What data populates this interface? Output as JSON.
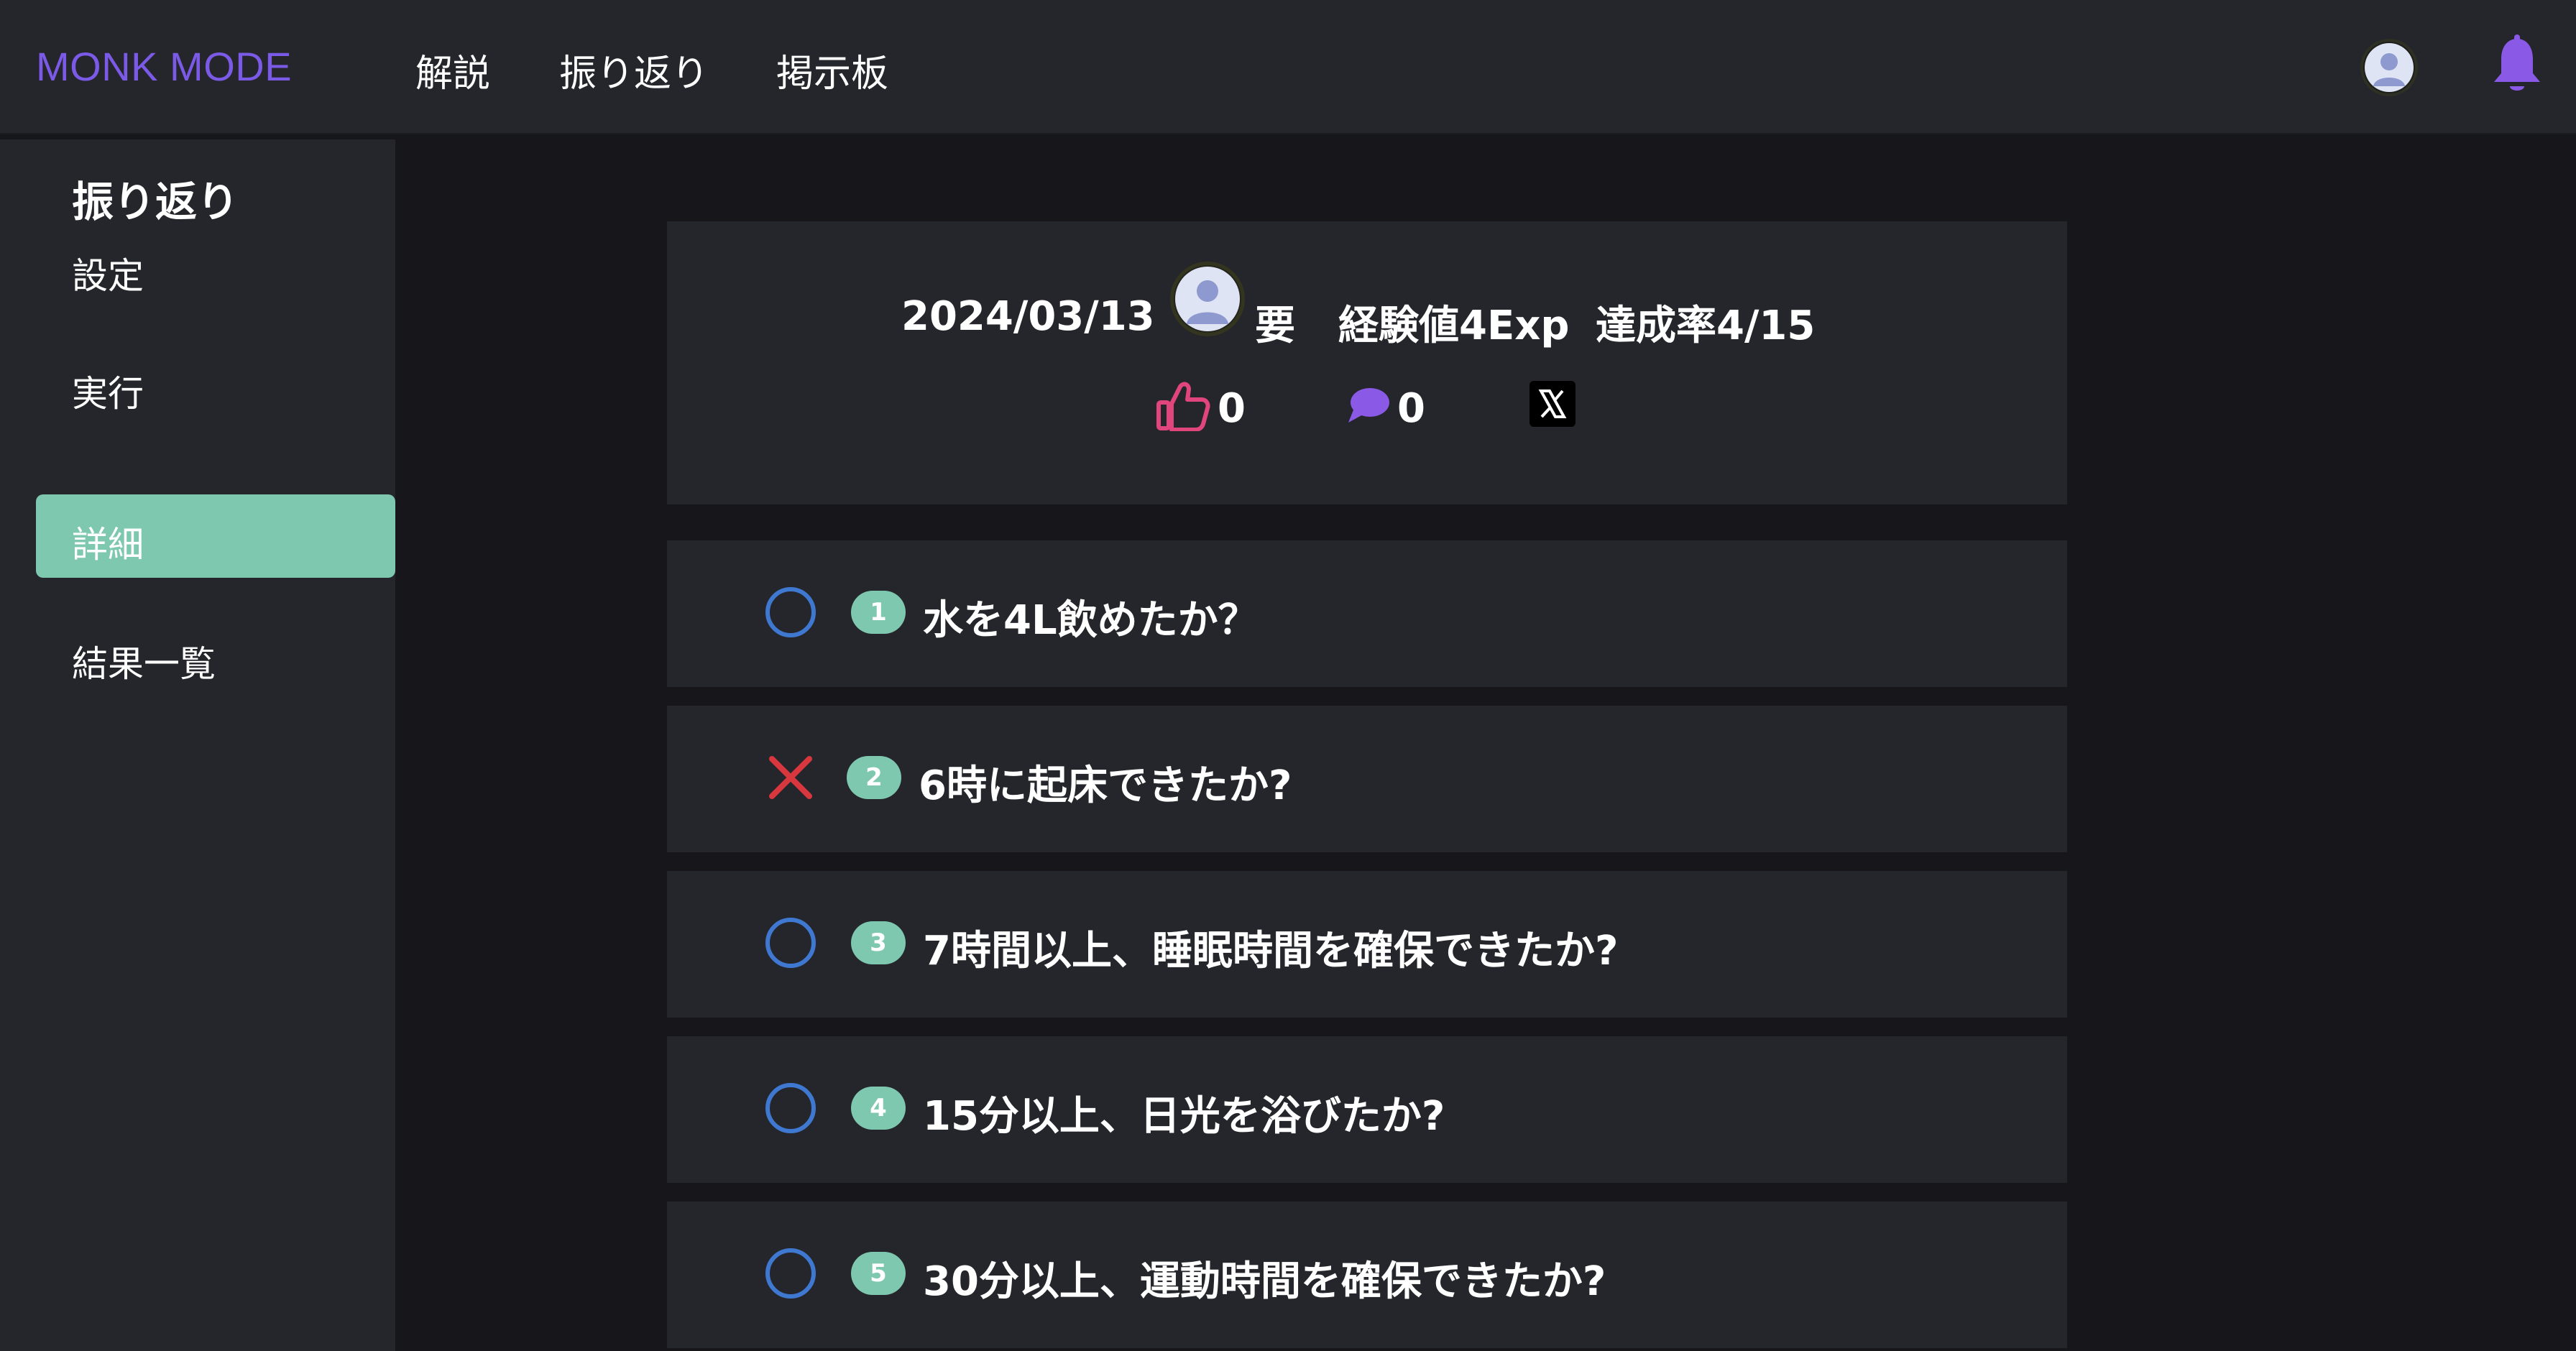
{
  "header": {
    "brand": "MONK MODE",
    "nav": [
      "解説",
      "振り返り",
      "掲示板"
    ],
    "icons": [
      "user-avatar-icon",
      "bell-icon"
    ]
  },
  "sidebar": {
    "title": "振り返り",
    "items": [
      {
        "label": "設定",
        "active": false
      },
      {
        "label": "実行",
        "active": false
      },
      {
        "label": "詳細",
        "active": true
      },
      {
        "label": "結果一覧",
        "active": false
      }
    ]
  },
  "summary": {
    "date": "2024/03/13",
    "user_name": "要",
    "exp": "経験値4Exp",
    "rate": "達成率4/15",
    "likes": "0",
    "comments": "0",
    "share_icon": "x-logo-icon"
  },
  "questions": [
    {
      "num": "1",
      "text": "水を4L飲めたか？",
      "status": "pending"
    },
    {
      "num": "2",
      "text": "6時に起床できたか?",
      "status": "failed"
    },
    {
      "num": "3",
      "text": "7時間以上、睡眠時間を確保できたか?",
      "status": "pending"
    },
    {
      "num": "4",
      "text": "15分以上、日光を浴びたか?",
      "status": "pending"
    },
    {
      "num": "5",
      "text": "30分以上、運動時間を確保できたか?",
      "status": "pending"
    }
  ],
  "colors": {
    "brand": "#7a5ae6",
    "accent": "#7ec8b0",
    "like": "#e0457b",
    "comment": "#8a5ae6",
    "circle": "#3f78d0",
    "cross": "#d8373e",
    "panel": "#25262b",
    "background": "#17171b"
  }
}
